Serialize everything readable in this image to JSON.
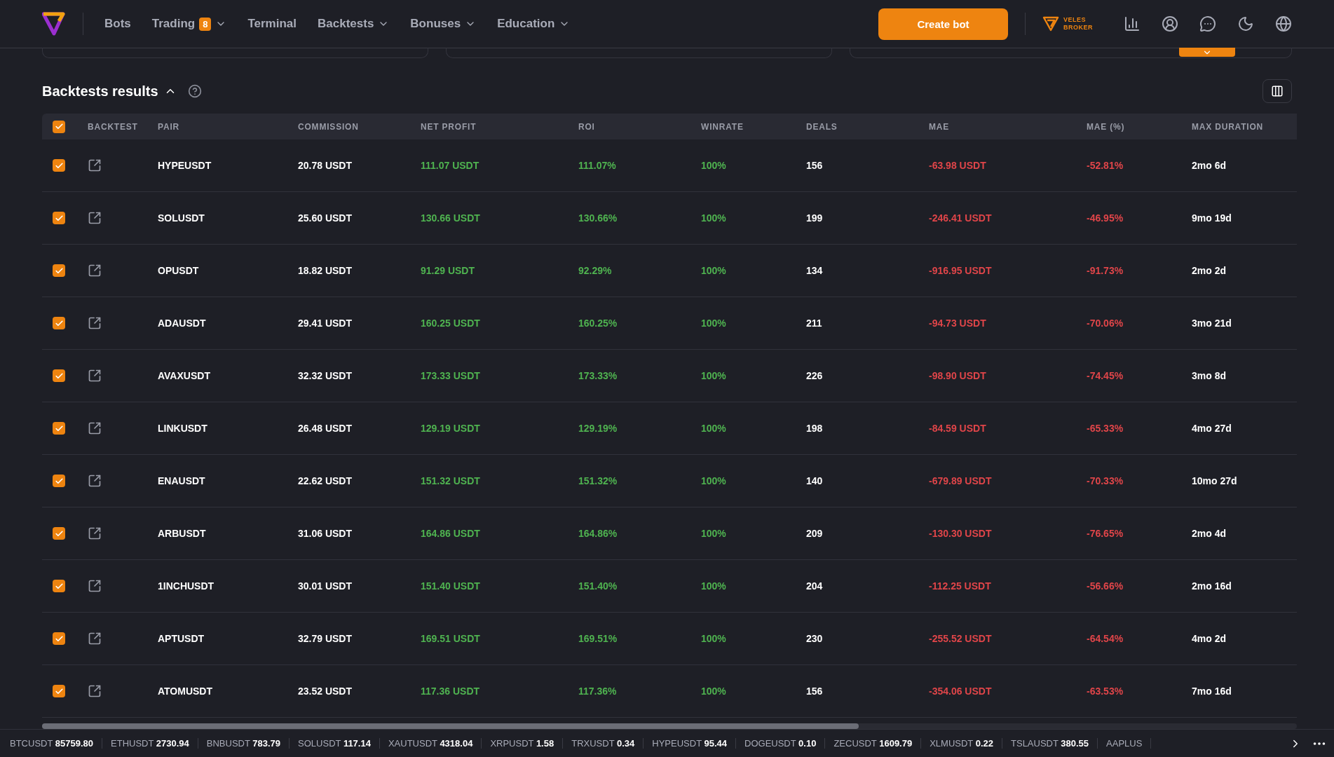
{
  "nav": {
    "items": [
      {
        "label": "Bots",
        "dropdown": false
      },
      {
        "label": "Trading",
        "badge": "8",
        "dropdown": true
      },
      {
        "label": "Terminal",
        "dropdown": false
      },
      {
        "label": "Backtests",
        "dropdown": true
      },
      {
        "label": "Bonuses",
        "dropdown": true
      },
      {
        "label": "Education",
        "dropdown": true
      }
    ],
    "create_button": "Create bot",
    "broker": [
      "VELES",
      "BROKER"
    ]
  },
  "section": {
    "title": "Backtests results",
    "expanded": true
  },
  "table": {
    "all_checked": true,
    "columns": [
      "BACKTEST",
      "PAIR",
      "COMMISSION",
      "NET PROFIT",
      "ROI",
      "WINRATE",
      "DEALS",
      "MAE",
      "MAE (%)",
      "MAX DURATION"
    ],
    "rows": [
      {
        "checked": true,
        "pair": "HYPEUSDT",
        "commission": "20.78 USDT",
        "net_profit": "111.07 USDT",
        "roi": "111.07%",
        "winrate": "100%",
        "deals": "156",
        "mae": "-63.98 USDT",
        "mae_pct": "-52.81%",
        "max_duration": "2mo 6d"
      },
      {
        "checked": true,
        "pair": "SOLUSDT",
        "commission": "25.60 USDT",
        "net_profit": "130.66 USDT",
        "roi": "130.66%",
        "winrate": "100%",
        "deals": "199",
        "mae": "-246.41 USDT",
        "mae_pct": "-46.95%",
        "max_duration": "9mo 19d"
      },
      {
        "checked": true,
        "pair": "OPUSDT",
        "commission": "18.82 USDT",
        "net_profit": "91.29 USDT",
        "roi": "92.29%",
        "winrate": "100%",
        "deals": "134",
        "mae": "-916.95 USDT",
        "mae_pct": "-91.73%",
        "max_duration": "2mo 2d"
      },
      {
        "checked": true,
        "pair": "ADAUSDT",
        "commission": "29.41 USDT",
        "net_profit": "160.25 USDT",
        "roi": "160.25%",
        "winrate": "100%",
        "deals": "211",
        "mae": "-94.73 USDT",
        "mae_pct": "-70.06%",
        "max_duration": "3mo 21d"
      },
      {
        "checked": true,
        "pair": "AVAXUSDT",
        "commission": "32.32 USDT",
        "net_profit": "173.33 USDT",
        "roi": "173.33%",
        "winrate": "100%",
        "deals": "226",
        "mae": "-98.90 USDT",
        "mae_pct": "-74.45%",
        "max_duration": "3mo 8d"
      },
      {
        "checked": true,
        "pair": "LINKUSDT",
        "commission": "26.48 USDT",
        "net_profit": "129.19 USDT",
        "roi": "129.19%",
        "winrate": "100%",
        "deals": "198",
        "mae": "-84.59 USDT",
        "mae_pct": "-65.33%",
        "max_duration": "4mo 27d"
      },
      {
        "checked": true,
        "pair": "ENAUSDT",
        "commission": "22.62 USDT",
        "net_profit": "151.32 USDT",
        "roi": "151.32%",
        "winrate": "100%",
        "deals": "140",
        "mae": "-679.89 USDT",
        "mae_pct": "-70.33%",
        "max_duration": "10mo 27d"
      },
      {
        "checked": true,
        "pair": "ARBUSDT",
        "commission": "31.06 USDT",
        "net_profit": "164.86 USDT",
        "roi": "164.86%",
        "winrate": "100%",
        "deals": "209",
        "mae": "-130.30 USDT",
        "mae_pct": "-76.65%",
        "max_duration": "2mo 4d"
      },
      {
        "checked": true,
        "pair": "1INCHUSDT",
        "commission": "30.01 USDT",
        "net_profit": "151.40 USDT",
        "roi": "151.40%",
        "winrate": "100%",
        "deals": "204",
        "mae": "-112.25 USDT",
        "mae_pct": "-56.66%",
        "max_duration": "2mo 16d"
      },
      {
        "checked": true,
        "pair": "APTUSDT",
        "commission": "32.79 USDT",
        "net_profit": "169.51 USDT",
        "roi": "169.51%",
        "winrate": "100%",
        "deals": "230",
        "mae": "-255.52 USDT",
        "mae_pct": "-64.54%",
        "max_duration": "4mo 2d"
      },
      {
        "checked": true,
        "pair": "ATOMUSDT",
        "commission": "23.52 USDT",
        "net_profit": "117.36 USDT",
        "roi": "117.36%",
        "winrate": "100%",
        "deals": "156",
        "mae": "-354.06 USDT",
        "mae_pct": "-63.53%",
        "max_duration": "7mo 16d"
      }
    ]
  },
  "ticker": [
    {
      "symbol": "BTCUSDT",
      "price": "85759.80"
    },
    {
      "symbol": "ETHUSDT",
      "price": "2730.94"
    },
    {
      "symbol": "BNBUSDT",
      "price": "783.79"
    },
    {
      "symbol": "SOLUSDT",
      "price": "117.14"
    },
    {
      "symbol": "XAUTUSDT",
      "price": "4318.04"
    },
    {
      "symbol": "XRPUSDT",
      "price": "1.58"
    },
    {
      "symbol": "TRXUSDT",
      "price": "0.34"
    },
    {
      "symbol": "HYPEUSDT",
      "price": "95.44"
    },
    {
      "symbol": "DOGEUSDT",
      "price": "0.10"
    },
    {
      "symbol": "ZECUSDT",
      "price": "1609.79"
    },
    {
      "symbol": "XLMUSDT",
      "price": "0.22"
    },
    {
      "symbol": "TSLAUSDT",
      "price": "380.55"
    },
    {
      "symbol": "AAPLUS"
    }
  ]
}
